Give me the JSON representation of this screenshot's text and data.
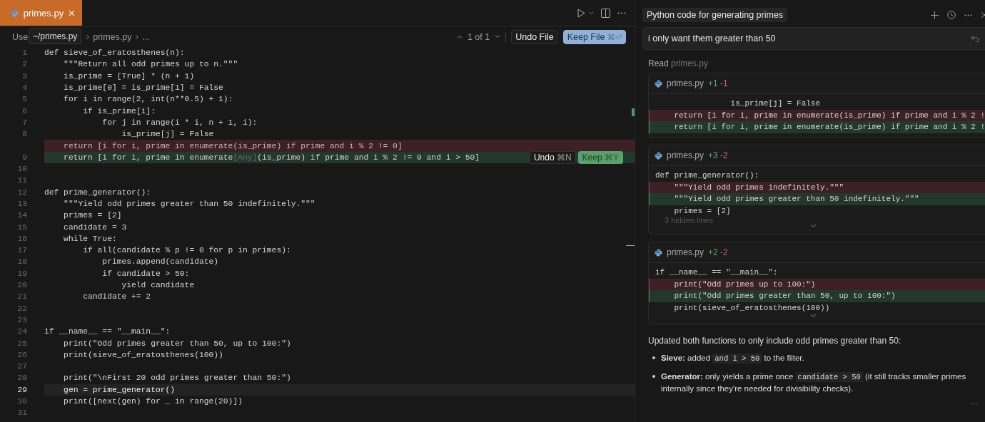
{
  "tab": {
    "label": "primes.py"
  },
  "tooltip": "~/primes.py",
  "breadcrumb": [
    "Use",
    "primes.py",
    "..."
  ],
  "diff_nav": {
    "position": "1 of 1",
    "undo": "Undo File",
    "keep": "Keep File",
    "keep_shortcut": "⌘⏎"
  },
  "inline_actions": {
    "undo": "Undo",
    "undo_shortcut": "⌘N",
    "keep": "Keep",
    "keep_shortcut": "⌘Y"
  },
  "editor": {
    "lines": [
      {
        "number": "1",
        "text": "def sieve_of_eratosthenes(n):",
        "kind": "normal",
        "current": false
      },
      {
        "number": "2",
        "text": "    \"\"\"Return all odd primes up to n.\"\"\"",
        "kind": "normal",
        "current": false
      },
      {
        "number": "3",
        "text": "    is_prime = [True] * (n + 1)",
        "kind": "normal",
        "current": false
      },
      {
        "number": "4",
        "text": "    is_prime[0] = is_prime[1] = False",
        "kind": "normal",
        "current": false
      },
      {
        "number": "5",
        "text": "    for i in range(2, int(n**0.5) + 1):",
        "kind": "normal",
        "current": false
      },
      {
        "number": "6",
        "text": "        if is_prime[i]:",
        "kind": "normal",
        "current": false
      },
      {
        "number": "7",
        "text": "            for j in range(i * i, n + 1, i):",
        "kind": "normal",
        "current": false
      },
      {
        "number": "8",
        "text": "                is_prime[j] = False",
        "kind": "normal",
        "current": false
      },
      {
        "text": "    return [i for i, prime in enumerate(is_prime) if prime and i % 2 != 0]",
        "kind": "deleted",
        "current": false
      },
      {
        "number": "9",
        "text": "    return [i for i, prime in enumerate",
        "hint": "[Any]",
        "text_after": "(is_prime) if prime and i % 2 != 0 and i > 50]",
        "kind": "added",
        "current": false
      },
      {
        "number": "10",
        "kind": "normal",
        "current": false
      },
      {
        "number": "11",
        "kind": "normal",
        "current": false
      },
      {
        "number": "12",
        "text": "def prime_generator():",
        "kind": "normal",
        "current": false
      },
      {
        "number": "13",
        "text": "    \"\"\"Yield odd primes greater than 50 indefinitely.\"\"\"",
        "kind": "normal",
        "current": false
      },
      {
        "number": "14",
        "text": "    primes = [2]",
        "kind": "normal",
        "current": false
      },
      {
        "number": "15",
        "text": "    candidate = 3",
        "kind": "normal",
        "current": false
      },
      {
        "number": "16",
        "text": "    while True:",
        "kind": "normal",
        "current": false
      },
      {
        "number": "17",
        "text": "        if all(candidate % p != 0 for p in primes):",
        "kind": "normal",
        "current": false
      },
      {
        "number": "18",
        "text": "            primes.append(candidate)",
        "kind": "normal",
        "current": false
      },
      {
        "number": "19",
        "text": "            if candidate > 50:",
        "kind": "normal",
        "current": false
      },
      {
        "number": "20",
        "text": "                yield candidate",
        "kind": "normal",
        "current": false
      },
      {
        "number": "21",
        "text": "        candidate += 2",
        "kind": "normal",
        "current": false
      },
      {
        "number": "22",
        "kind": "normal",
        "current": false
      },
      {
        "number": "23",
        "kind": "normal",
        "current": false
      },
      {
        "number": "24",
        "text": "if __name__ == \"__main__\":",
        "kind": "normal",
        "current": false
      },
      {
        "number": "25",
        "text": "    print(\"Odd primes greater than 50, up to 100:\")",
        "kind": "normal",
        "current": false
      },
      {
        "number": "26",
        "text": "    print(sieve_of_eratosthenes(100))",
        "kind": "normal",
        "current": false
      },
      {
        "number": "27",
        "kind": "normal",
        "current": false
      },
      {
        "number": "28",
        "text": "    print(\"\\nFirst 20 odd primes greater than 50:\")",
        "kind": "normal",
        "current": false
      },
      {
        "number": "29",
        "text": "    gen = prime_generator()",
        "kind": "normal",
        "current": true
      },
      {
        "number": "30",
        "text": "    print([next(gen) for _ in range(20)])",
        "kind": "normal",
        "current": false
      },
      {
        "number": "31",
        "kind": "normal",
        "current": false
      }
    ]
  },
  "chat": {
    "title": "Python code for generating primes",
    "message": "i only want them greater than 50",
    "read_label": "Read",
    "read_file": "primes.py",
    "cards": [
      {
        "file": "primes.py",
        "added": "+1",
        "removed": "-1",
        "lines": [
          {
            "text": "                is_prime[j] = False",
            "kind": "context"
          },
          {
            "text": "    return [i for i, prime in enumerate(is_prime) if prime and i % 2 !",
            "kind": "deleted"
          },
          {
            "text": "    return [i for i, prime in enumerate(is_prime) if prime and i % 2 !",
            "kind": "added"
          }
        ],
        "expandable": false
      },
      {
        "file": "primes.py",
        "added": "+3",
        "removed": "-2",
        "lines": [
          {
            "text": "def prime_generator():",
            "kind": "context"
          },
          {
            "text": "    \"\"\"Yield odd primes indefinitely.\"\"\"",
            "kind": "deleted"
          },
          {
            "text": "    \"\"\"Yield odd primes greater than 50 indefinitely.\"\"\"",
            "kind": "added"
          },
          {
            "text": "    primes = [2]",
            "kind": "context"
          }
        ],
        "hidden_lines": "3 hidden lines",
        "expandable": true
      },
      {
        "file": "primes.py",
        "added": "+2",
        "removed": "-2",
        "lines": [
          {
            "text": "if __name__ == \"__main__\":",
            "kind": "context"
          },
          {
            "text": "    print(\"Odd primes up to 100:\")",
            "kind": "deleted"
          },
          {
            "text": "    print(\"Odd primes greater than 50, up to 100:\")",
            "kind": "added"
          },
          {
            "text": "    print(sieve_of_eratosthenes(100))",
            "kind": "context"
          }
        ],
        "expandable": true
      }
    ],
    "summary": "Updated both functions to only include odd primes greater than 50:",
    "bullets": [
      {
        "label": "Sieve:",
        "before": "added",
        "code": "and i > 50",
        "after": "to the filter."
      },
      {
        "label": "Generator:",
        "before": "only yields a prime once",
        "code": "candidate > 50",
        "after": "(it still tracks smaller primes internally since they're needed for divisibility checks)."
      }
    ]
  }
}
